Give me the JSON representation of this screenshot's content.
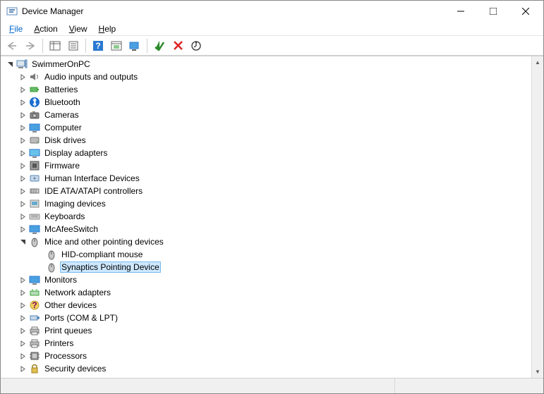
{
  "window": {
    "title": "Device Manager"
  },
  "menu": {
    "file": "File",
    "action": "Action",
    "view": "View",
    "help": "Help"
  },
  "tree": {
    "root": "SwimmerOnPC",
    "categories": [
      {
        "label": "Audio inputs and outputs",
        "icon": "speaker"
      },
      {
        "label": "Batteries",
        "icon": "battery"
      },
      {
        "label": "Bluetooth",
        "icon": "bluetooth"
      },
      {
        "label": "Cameras",
        "icon": "camera"
      },
      {
        "label": "Computer",
        "icon": "monitor"
      },
      {
        "label": "Disk drives",
        "icon": "disk"
      },
      {
        "label": "Display adapters",
        "icon": "display"
      },
      {
        "label": "Firmware",
        "icon": "firmware"
      },
      {
        "label": "Human Interface Devices",
        "icon": "hid"
      },
      {
        "label": "IDE ATA/ATAPI controllers",
        "icon": "ide"
      },
      {
        "label": "Imaging devices",
        "icon": "imaging"
      },
      {
        "label": "Keyboards",
        "icon": "keyboard"
      },
      {
        "label": "McAfeeSwitch",
        "icon": "monitor"
      },
      {
        "label": "Mice and other pointing devices",
        "icon": "mouse",
        "expanded": true,
        "children": [
          {
            "label": "HID-compliant mouse",
            "icon": "mouse"
          },
          {
            "label": "Synaptics Pointing Device",
            "icon": "mouse",
            "selected": true
          }
        ]
      },
      {
        "label": "Monitors",
        "icon": "monitor"
      },
      {
        "label": "Network adapters",
        "icon": "network"
      },
      {
        "label": "Other devices",
        "icon": "other"
      },
      {
        "label": "Ports (COM & LPT)",
        "icon": "port"
      },
      {
        "label": "Print queues",
        "icon": "printer"
      },
      {
        "label": "Printers",
        "icon": "printer"
      },
      {
        "label": "Processors",
        "icon": "processor"
      },
      {
        "label": "Security devices",
        "icon": "security"
      }
    ]
  }
}
